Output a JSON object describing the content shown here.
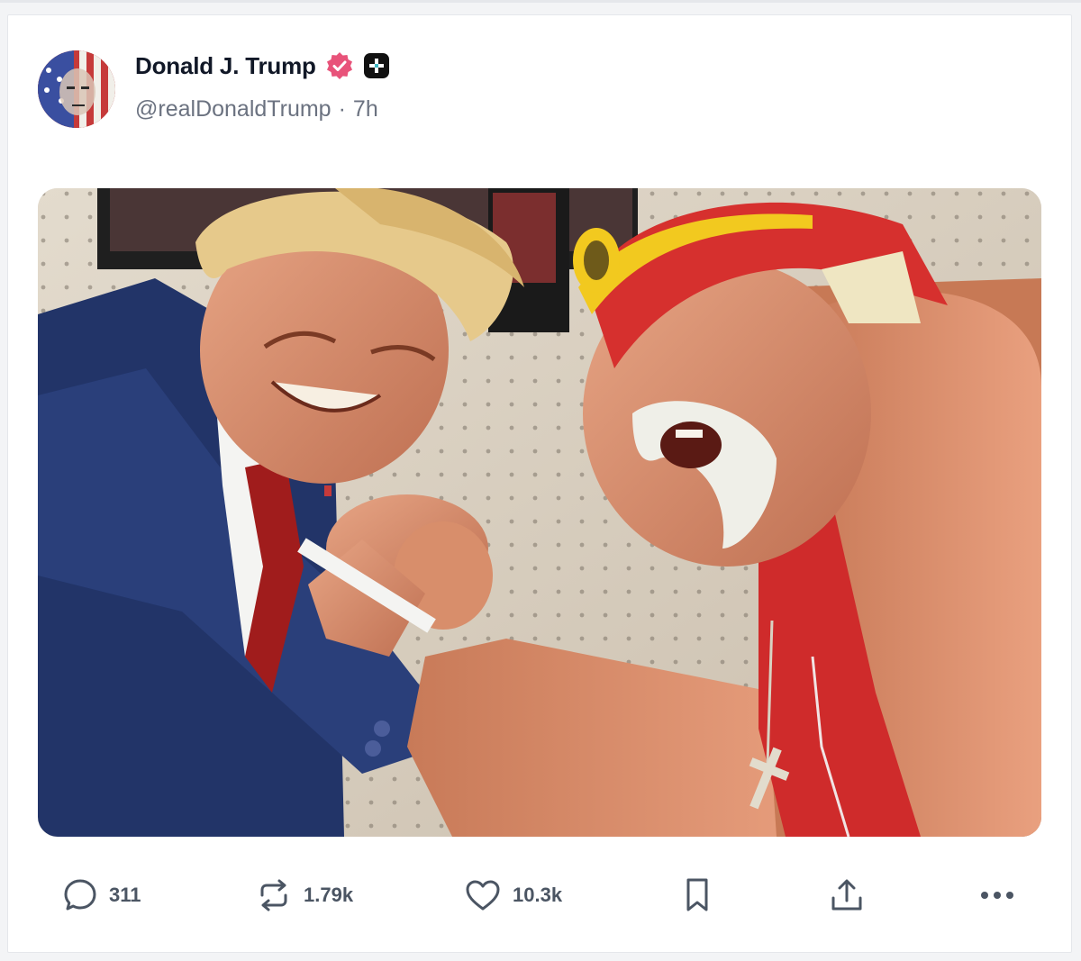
{
  "post": {
    "author_name": "Donald J. Trump",
    "handle": "@realDonaldTrump",
    "separator": "·",
    "time": "7h",
    "badges": {
      "verified_color": "#e8537a",
      "plus_badge_color": "#111111"
    }
  },
  "actions": {
    "replies": "311",
    "reposts": "1.79k",
    "likes": "10.3k",
    "icons": [
      "reply-icon",
      "repost-icon",
      "like-icon",
      "bookmark-icon",
      "share-icon",
      "more-icon"
    ]
  }
}
